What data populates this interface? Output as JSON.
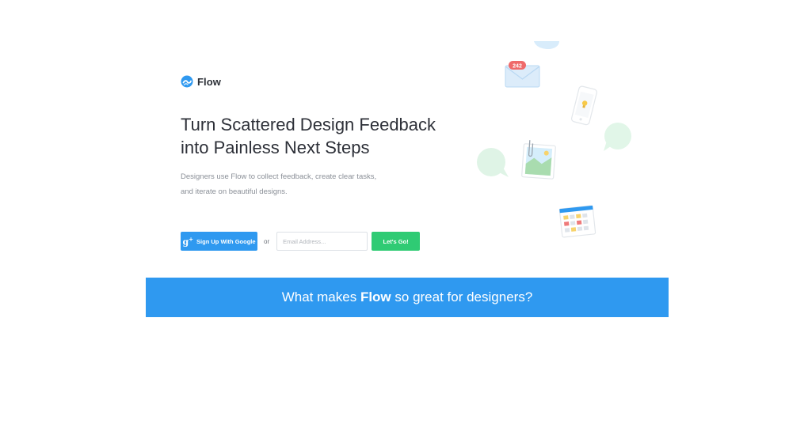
{
  "brand": {
    "name": "Flow",
    "colors": {
      "primary": "#2f99f0",
      "success": "#2fcb74",
      "text": "#2d3038",
      "muted": "#8a8f97"
    }
  },
  "hero": {
    "headline_line1": "Turn Scattered Design Feedback",
    "headline_line2": "into Painless Next Steps",
    "subtext_line1": "Designers use Flow to collect feedback, create clear tasks,",
    "subtext_line2": "and iterate on beautiful designs."
  },
  "signup": {
    "google_label": "Sign Up With Google",
    "or_label": "or",
    "email_placeholder": "Email Address...",
    "go_label": "Let's Go!"
  },
  "illustration": {
    "mail_badge": "242",
    "icons": [
      "mail-icon",
      "phone-icon",
      "chat-bubble-icon",
      "photo-icon",
      "calendar-icon"
    ]
  },
  "banner": {
    "prefix": "What makes",
    "highlight": "Flow",
    "suffix": "so great for designers?"
  }
}
